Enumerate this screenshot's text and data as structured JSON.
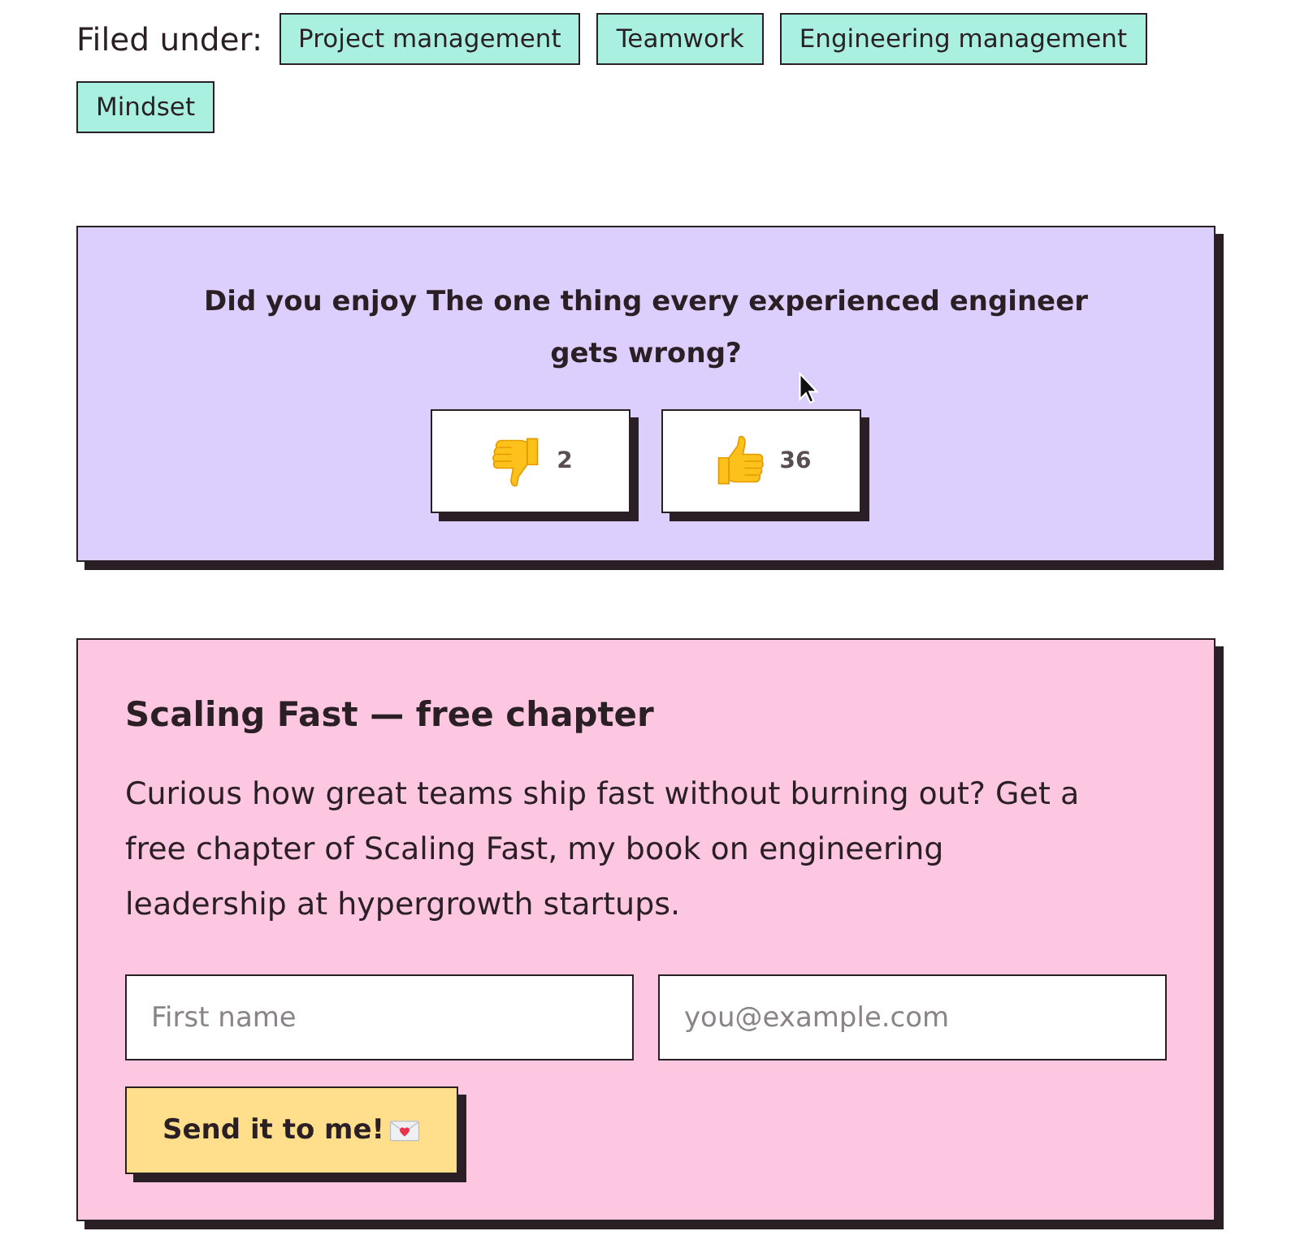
{
  "tags": {
    "label": "Filed under:",
    "items": [
      "Project management",
      "Teamwork",
      "Engineering management",
      "Mindset"
    ]
  },
  "feedback": {
    "question": "Did you enjoy The one thing every experienced engineer gets wrong?",
    "votes": [
      {
        "kind": "down",
        "count": "2"
      },
      {
        "kind": "up",
        "count": "36"
      }
    ]
  },
  "signup": {
    "title": "Scaling Fast — free chapter",
    "description": "Curious how great teams ship fast without burning out? Get a free chapter of Scaling Fast, my book on engineering leadership at hypergrowth startups.",
    "fields": [
      {
        "placeholder": "First name"
      },
      {
        "placeholder": "you@example.com"
      }
    ],
    "button": {
      "label": "Send it to me!"
    }
  }
}
